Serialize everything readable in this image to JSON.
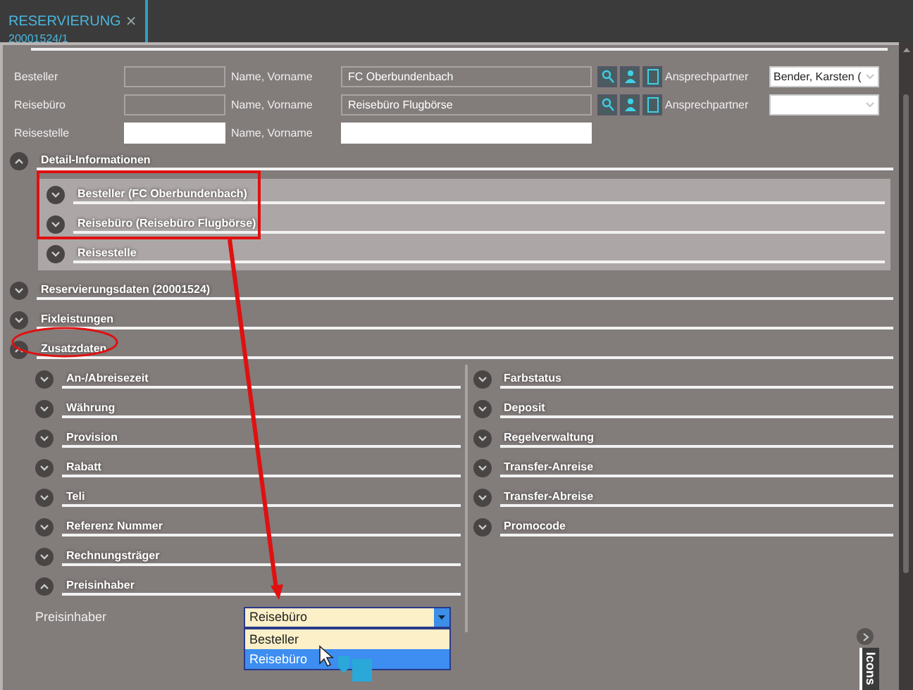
{
  "tab": {
    "title": "RESERVIERUNG",
    "close": "×",
    "subtitle": "20001524/1"
  },
  "contacts": [
    {
      "kind": "lookup",
      "label": "Besteller",
      "name_label": "Name, Vorname",
      "name": "FC Oberbundenbach",
      "contact_label": "Ansprechpartner",
      "contact": "Bender, Karsten ("
    },
    {
      "kind": "lookup",
      "label": "Reisebüro",
      "name_label": "Name, Vorname",
      "name": "Reisebüro Flugbörse",
      "contact_label": "Ansprechpartner"
    },
    {
      "kind": "plain",
      "label": "Reisestelle",
      "name_label": "Name, Vorname"
    }
  ],
  "sections": [
    {
      "kind": "panel",
      "title": "Detail-Informationen",
      "expanded": true,
      "items": [
        {
          "title": "Besteller (FC Oberbundenbach)",
          "expanded": false
        },
        {
          "title": "Reisebüro (Reisebüro Flugbörse)",
          "expanded": false
        },
        {
          "title": "Reisestelle",
          "expanded": false
        }
      ]
    },
    {
      "title": "Reservierungsdaten (20001524)",
      "expanded": false
    },
    {
      "title": "Fixleistungen",
      "expanded": false
    },
    {
      "kind": "columns",
      "title": "Zusatzdaten",
      "expanded": true,
      "columns": [
        [
          {
            "title": "An-/Abreisezeit",
            "expanded": false
          },
          {
            "title": "Währung",
            "expanded": false
          },
          {
            "title": "Provision",
            "expanded": false
          },
          {
            "title": "Rabatt",
            "expanded": false
          },
          {
            "title": "Teli",
            "expanded": false
          },
          {
            "title": "Referenz Nummer",
            "expanded": false
          },
          {
            "title": "Rechnungsträger",
            "expanded": false
          },
          {
            "title": "Preisinhaber",
            "expanded": true,
            "field": {
              "label": "Preisinhaber",
              "value": "Reisebüro",
              "options": [
                {
                  "label": "Besteller",
                  "selected": false
                },
                {
                  "label": "Reisebüro",
                  "selected": true
                }
              ]
            }
          }
        ],
        [
          {
            "title": "Farbstatus",
            "expanded": false
          },
          {
            "title": "Deposit",
            "expanded": false
          },
          {
            "title": "Regelverwaltung",
            "expanded": false
          },
          {
            "title": "Transfer-Anreise",
            "expanded": false
          },
          {
            "title": "Transfer-Abreise",
            "expanded": false
          },
          {
            "title": "Promocode",
            "expanded": false
          }
        ]
      ]
    }
  ],
  "side_tab": {
    "label": "Icons"
  }
}
